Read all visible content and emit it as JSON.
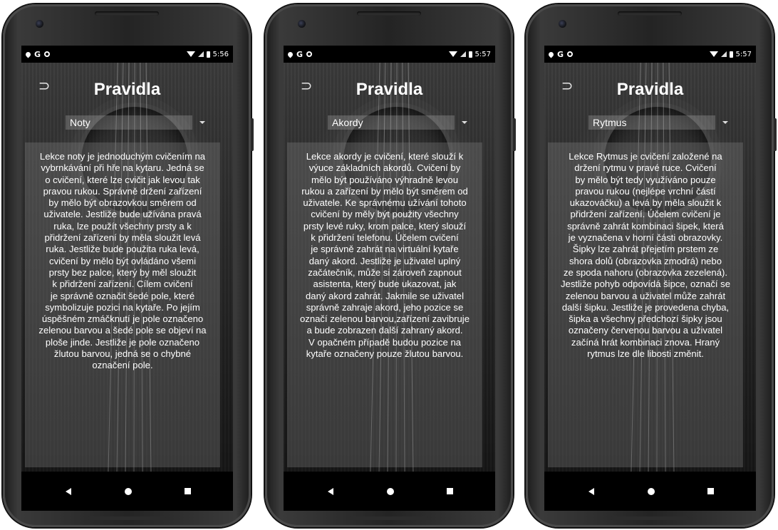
{
  "title": "Pravidla",
  "icons": {
    "back": "back-arrow-icon",
    "status_left": [
      "location-icon",
      "google-icon",
      "circle-icon"
    ],
    "status_right": [
      "wifi-icon",
      "signal-icon",
      "battery-icon"
    ],
    "nav": [
      "nav-back-icon",
      "nav-home-icon",
      "nav-recents-icon"
    ]
  },
  "phones": [
    {
      "status_time": "5:56",
      "status_g": "G",
      "dropdown_value": "Noty",
      "rules_lines": [
        "Lekce noty je jednoduchým cvičením na",
        "vybrnkávání při hře na kytaru. Jedná se",
        "o cvičení, které lze cvičit jak levou tak",
        "pravou rukou. Správně držení zařízení",
        "by mělo být obrazovkou směrem od",
        "uživatele. Jestliže bude užívána pravá",
        "ruka, lze použít všechny prsty a k",
        "přidržení zařízení by měla sloužit levá",
        "ruka. Jestliže bude použita ruka levá,",
        "cvičení by mělo být ovládáno všemi",
        "prsty bez palce, který by měl sloužit",
        "k přidržení zařízení. Cílem cvičení",
        "je správně označit šedé pole, které",
        "symbolizuje pozici na kytaře. Po jejím",
        "úspěšném zmáčknutí je pole označeno",
        "zelenou barvou a šedé pole se objeví na",
        "ploše jinde. Jestliže je pole označeno",
        "žlutou barvou, jedná se o chybné",
        "označení pole."
      ]
    },
    {
      "status_time": "5:57",
      "status_g": "G",
      "dropdown_value": "Akordy",
      "rules_lines": [
        "Lekce akordy je cvičení, které slouží k",
        "výuce základních akordů. Cvičení by",
        "mělo být používáno výhradně levou",
        "rukou a zařízení by mělo být směrem od",
        "uživatele. Ke správnému užívání tohoto",
        "cvičení by měly být použity všechny",
        "prsty levé ruky, krom palce, který slouží",
        "k přidržení telefonu. Účelem cvičení",
        "je správně zahrát na virtuální kytaře",
        "daný akord. Jestliže je uživatel uplný",
        "začátečník, může si zároveň zapnout",
        "asistenta, který bude ukazovat, jak",
        "daný akord zahrát. Jakmile se uživatel",
        "správně zahraje akord, jeho pozice se",
        "označí zelenou barvou,zařízení zavibruje",
        "a bude zobrazen další zahraný akord.",
        "V opačném případě budou pozice na",
        "kytaře označeny pouze žlutou barvou."
      ]
    },
    {
      "status_time": "5:57",
      "status_g": "G",
      "dropdown_value": "Rytmus",
      "rules_lines": [
        "Lekce Rytmus je cvičení založené na",
        "držení rytmu v pravé ruce. Cvičení",
        "by mělo být tedy využíváno pouze",
        "pravou rukou (nejlépe vrchní částí",
        "ukazováčku) a levá by měla sloužit k",
        "přidržení zařízení. Účelem cvičení je",
        "správně zahrát kombinaci šipek, která",
        "je vyznačena v horní části obrazovky.",
        "Šipky lze zahrát přejetím prstem ze",
        "shora dolů (obrazovka zmodrá) nebo",
        "ze spoda nahoru (obrazovka zezelená).",
        "Jestliže pohyb odpovídá šipce, označí se",
        "zelenou barvou a uživatel může zahrát",
        "další šipku. Jestliže je provedena chyba,",
        "šipka a všechny předchozí šipky jsou",
        "označeny červenou barvou a uživatel",
        "začíná hrát kombinaci znova. Hraný",
        "rytmus lze dle libosti změnit."
      ]
    }
  ]
}
